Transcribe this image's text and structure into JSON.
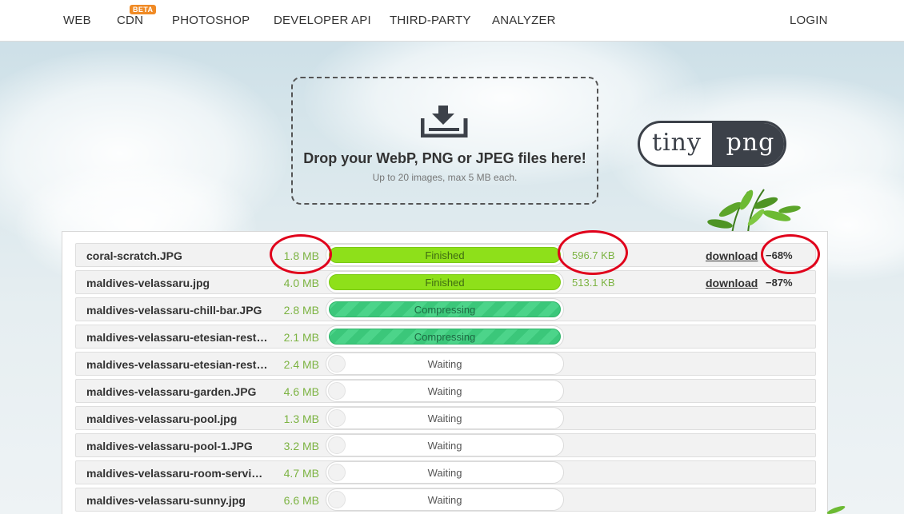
{
  "nav": {
    "items": [
      "WEB",
      "CDN",
      "PHOTOSHOP",
      "DEVELOPER API",
      "THIRD-PARTY",
      "ANALYZER"
    ],
    "badge": "BETA",
    "login": "LOGIN"
  },
  "dropzone": {
    "title": "Drop your WebP, PNG or JPEG files here!",
    "subtitle": "Up to 20 images, max 5 MB each."
  },
  "logo": {
    "left": "tiny",
    "right": "png"
  },
  "files": [
    {
      "name": "coral-scratch.JPG",
      "size": "1.8 MB",
      "status": "Finished",
      "new_size": "596.7 KB",
      "download": "download",
      "saving": "−68%"
    },
    {
      "name": "maldives-velassaru.jpg",
      "size": "4.0 MB",
      "status": "Finished",
      "new_size": "513.1 KB",
      "download": "download",
      "saving": "−87%"
    },
    {
      "name": "maldives-velassaru-chill-bar.JPG",
      "size": "2.8 MB",
      "status": "Compressing"
    },
    {
      "name": "maldives-velassaru-etesian-rest…",
      "size": "2.1 MB",
      "status": "Compressing"
    },
    {
      "name": "maldives-velassaru-etesian-rest…",
      "size": "2.4 MB",
      "status": "Waiting"
    },
    {
      "name": "maldives-velassaru-garden.JPG",
      "size": "4.6 MB",
      "status": "Waiting"
    },
    {
      "name": "maldives-velassaru-pool.jpg",
      "size": "1.3 MB",
      "status": "Waiting"
    },
    {
      "name": "maldives-velassaru-pool-1.JPG",
      "size": "3.2 MB",
      "status": "Waiting"
    },
    {
      "name": "maldives-velassaru-room-servi…",
      "size": "4.7 MB",
      "status": "Waiting"
    },
    {
      "name": "maldives-velassaru-sunny.jpg",
      "size": "6.6 MB",
      "status": "Waiting"
    }
  ],
  "colors": {
    "finished": "#8ee01a",
    "compressing": "#3bc77a",
    "size_text": "#7cb342",
    "annotation": "#e0001b"
  }
}
